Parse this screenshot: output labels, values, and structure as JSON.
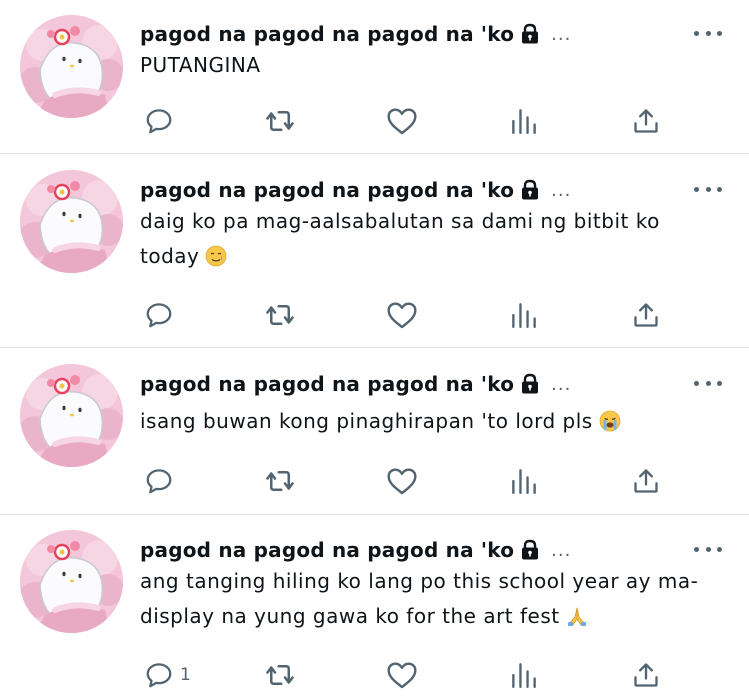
{
  "colors": {
    "icon": "#536471",
    "text": "#0f1419",
    "separator": "#dfe3e6",
    "avatar_bg": "#f7d6e4"
  },
  "tweets": [
    {
      "name": "pagod na pagod na pagod na 'ko",
      "trail": "...",
      "text": "PUTANGINA",
      "reply_count": ""
    },
    {
      "name": "pagod na pagod na pagod na 'ko",
      "trail": "...",
      "text": "daig ko pa mag-aalsabalutan sa dami ng bitbit ko",
      "text_line2": "today",
      "emoji": "crying-smile-emoji",
      "reply_count": ""
    },
    {
      "name": "pagod na pagod na pagod na 'ko",
      "trail": "...",
      "text": "isang buwan kong pinaghirapan 'to lord pls",
      "emoji": "loudly-crying-emoji",
      "reply_count": ""
    },
    {
      "name": "pagod na pagod na pagod na 'ko",
      "trail": "...",
      "text": "ang tanging hiling ko lang po this school year ay ma-",
      "text_line2": "display na yung gawa ko for the art fest",
      "emoji": "folded-hands-emoji",
      "reply_count": "1"
    }
  ]
}
